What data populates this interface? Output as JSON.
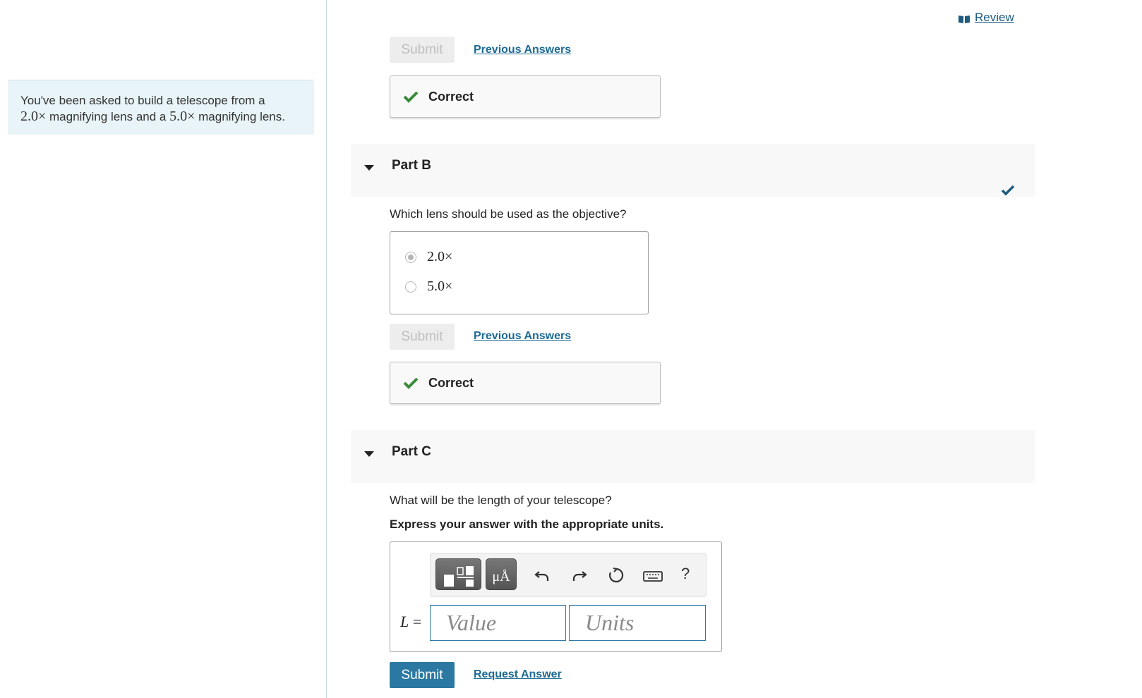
{
  "intro": {
    "line1": "You've been asked to build a telescope from a",
    "lens1": "2.0×",
    "mid": " magnifying lens and a ",
    "lens2": "5.0×",
    "end": " magnifying lens."
  },
  "header": {
    "review_label": "Review"
  },
  "part_a_tail": {
    "submit_label": "Submit",
    "previous_answers_label": "Previous Answers",
    "feedback_label": "Correct"
  },
  "part_b": {
    "title": "Part B",
    "question": "Which lens should be used as the objective?",
    "options": [
      {
        "label": "2.0×",
        "selected": true
      },
      {
        "label": "5.0×",
        "selected": false
      }
    ],
    "submit_label": "Submit",
    "previous_answers_label": "Previous Answers",
    "feedback_label": "Correct"
  },
  "part_c": {
    "title": "Part C",
    "question": "What will be the length of your telescope?",
    "instruction": "Express your answer with the appropriate units.",
    "variable": "L",
    "equals": " =",
    "toolbar": {
      "templates_icon": "templates-icon",
      "units_label": "μÅ",
      "help_label": "?"
    },
    "value_placeholder": "Value",
    "units_placeholder": "Units",
    "submit_label": "Submit",
    "request_answer_label": "Request Answer"
  },
  "colors": {
    "accent": "#2b79a2",
    "link": "#1d6a94",
    "correct_green": "#3a8a3a",
    "intro_bg": "#e8f4f7"
  }
}
